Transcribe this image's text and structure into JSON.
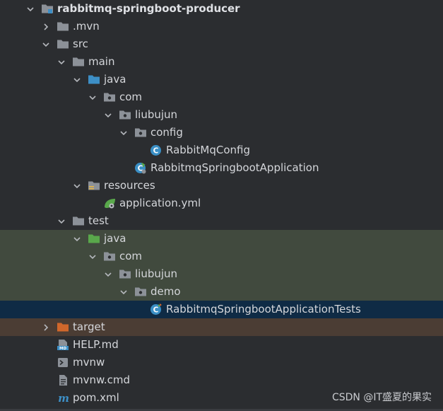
{
  "tree": {
    "rows": [
      {
        "label": "rabbitmq-springboot-producer",
        "depth": 0,
        "chevron": "down",
        "icon": "module-icon",
        "bold": true,
        "bg": ""
      },
      {
        "label": ".mvn",
        "depth": 1,
        "chevron": "right",
        "icon": "folder-icon",
        "bg": ""
      },
      {
        "label": "src",
        "depth": 1,
        "chevron": "down",
        "icon": "folder-icon",
        "bg": ""
      },
      {
        "label": "main",
        "depth": 2,
        "chevron": "down",
        "icon": "folder-icon",
        "bg": ""
      },
      {
        "label": "java",
        "depth": 3,
        "chevron": "down",
        "icon": "source-folder-icon",
        "bg": ""
      },
      {
        "label": "com",
        "depth": 4,
        "chevron": "down",
        "icon": "package-icon",
        "bg": ""
      },
      {
        "label": "liubujun",
        "depth": 5,
        "chevron": "down",
        "icon": "package-icon",
        "bg": ""
      },
      {
        "label": "config",
        "depth": 6,
        "chevron": "down",
        "icon": "package-icon",
        "bg": ""
      },
      {
        "label": "RabbitMqConfig",
        "depth": 7,
        "chevron": "",
        "icon": "java-class-icon",
        "bg": ""
      },
      {
        "label": "RabbitmqSpringbootApplication",
        "depth": 6,
        "chevron": "",
        "icon": "spring-boot-class-icon",
        "bg": ""
      },
      {
        "label": "resources",
        "depth": 3,
        "chevron": "down",
        "icon": "resources-folder-icon",
        "bg": ""
      },
      {
        "label": "application.yml",
        "depth": 4,
        "chevron": "",
        "icon": "spring-yml-icon",
        "bg": ""
      },
      {
        "label": "test",
        "depth": 2,
        "chevron": "down",
        "icon": "folder-icon",
        "bg": ""
      },
      {
        "label": "java",
        "depth": 3,
        "chevron": "down",
        "icon": "test-source-folder-icon",
        "bg": "test"
      },
      {
        "label": "com",
        "depth": 4,
        "chevron": "down",
        "icon": "package-icon",
        "bg": "test"
      },
      {
        "label": "liubujun",
        "depth": 5,
        "chevron": "down",
        "icon": "package-icon",
        "bg": "test"
      },
      {
        "label": "demo",
        "depth": 6,
        "chevron": "down",
        "icon": "package-icon",
        "bg": "test"
      },
      {
        "label": "RabbitmqSpringbootApplicationTests",
        "depth": 7,
        "chevron": "",
        "icon": "test-class-icon",
        "bg": "selected"
      },
      {
        "label": "target",
        "depth": 1,
        "chevron": "right",
        "icon": "excluded-folder-icon",
        "bg": "excluded"
      },
      {
        "label": "HELP.md",
        "depth": 1,
        "chevron": "",
        "icon": "markdown-file-icon",
        "bg": ""
      },
      {
        "label": "mvnw",
        "depth": 1,
        "chevron": "",
        "icon": "shell-script-icon",
        "bg": ""
      },
      {
        "label": "mvnw.cmd",
        "depth": 1,
        "chevron": "",
        "icon": "text-file-icon",
        "bg": ""
      },
      {
        "label": "pom.xml",
        "depth": 1,
        "chevron": "",
        "icon": "maven-pom-icon",
        "bg": ""
      }
    ]
  },
  "watermark": "CSDN @IT盛夏的果实",
  "colors": {
    "background": "#2b2d30",
    "test_highlight": "#414a3e",
    "selected": "#0f2b45",
    "excluded": "#4b3d34",
    "folder": "#8c9198",
    "source_folder": "#3d8fc6",
    "test_folder": "#59a84b",
    "class_icon": "#3a8fc5",
    "excluded_folder": "#d0672b"
  }
}
